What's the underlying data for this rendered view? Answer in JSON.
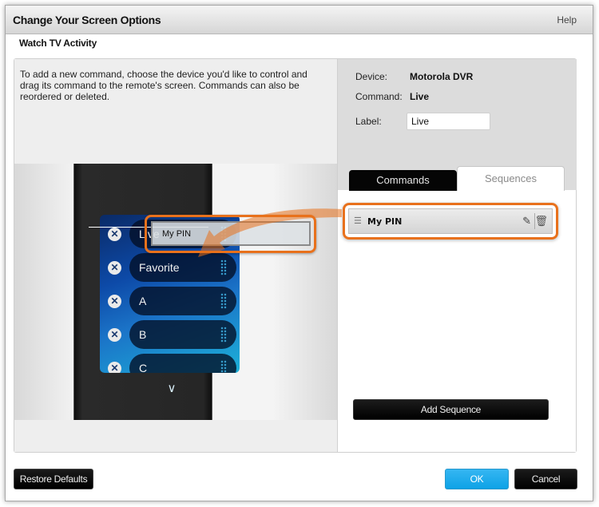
{
  "dialog": {
    "title": "Change Your Screen Options",
    "help_label": "Help",
    "subtitle": "Watch TV Activity"
  },
  "left_pane": {
    "instructions": "To add a new command, choose the device you'd like to control and drag its command to the remote's screen. Commands can also be reordered or deleted.",
    "remote_screen_items": [
      {
        "label": "Live"
      },
      {
        "label": "Favorite"
      },
      {
        "label": "A"
      },
      {
        "label": "B"
      },
      {
        "label": "C"
      }
    ],
    "drag_ghost_label": "My PIN"
  },
  "right_pane": {
    "device_label": "Device:",
    "device_value": "Motorola DVR",
    "command_label": "Command:",
    "command_value": "Live",
    "label_label": "Label:",
    "label_value": "Live",
    "tabs": [
      {
        "label": "Commands",
        "active": false
      },
      {
        "label": "Sequences",
        "active": true
      }
    ],
    "sequences": [
      {
        "name": "My PIN"
      }
    ],
    "add_sequence_label": "Add Sequence"
  },
  "footer": {
    "restore_label": "Restore Defaults",
    "ok_label": "OK",
    "cancel_label": "Cancel"
  },
  "colors": {
    "highlight": "#e8711c",
    "ok_button": "#18a9ec",
    "tab_active_text": "#8a8a8a"
  }
}
